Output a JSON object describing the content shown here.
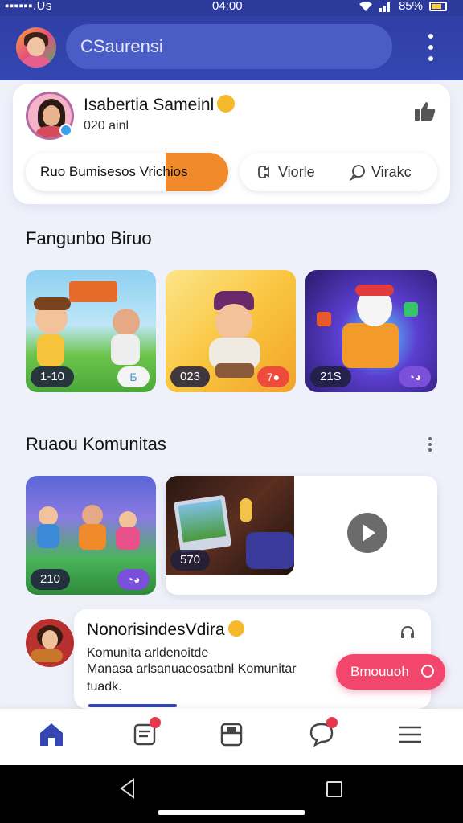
{
  "status": {
    "left": "▪▪▪▪▪▪.Ʋs",
    "time": "04:00",
    "battery": "85%"
  },
  "appbar": {
    "search_text": "CSaurensi"
  },
  "profile": {
    "name": "Isabertia Sameinl",
    "subtitle": "020 ainl",
    "tabs": {
      "primary_label": "Ruo Bumisesos Vrichios",
      "video_label": "Viorle",
      "live_label": "Virakc"
    }
  },
  "sections": {
    "section1_title": "Fangunbo Biruo",
    "section2_title": "Ruaou Komunitas"
  },
  "thumbs": [
    {
      "count": "1-10",
      "icon": "Б"
    },
    {
      "count": "023",
      "icon": "7●"
    },
    {
      "count": "21S",
      "icon": "◔◕"
    },
    {
      "count": "210",
      "icon": "◔◕"
    },
    {
      "count": "570",
      "icon": ""
    }
  ],
  "notification": {
    "title": "NonorisindesVdira",
    "line1": "Komunita arldenoitde",
    "line2": "Manasa arlsanuaeosatbnl Komunitar",
    "line3": "tuadk.",
    "cta": "Bmouuoh"
  },
  "colors": {
    "primary": "#3446b2",
    "accent_orange": "#f08a2a",
    "accent_pink": "#f2466c"
  }
}
